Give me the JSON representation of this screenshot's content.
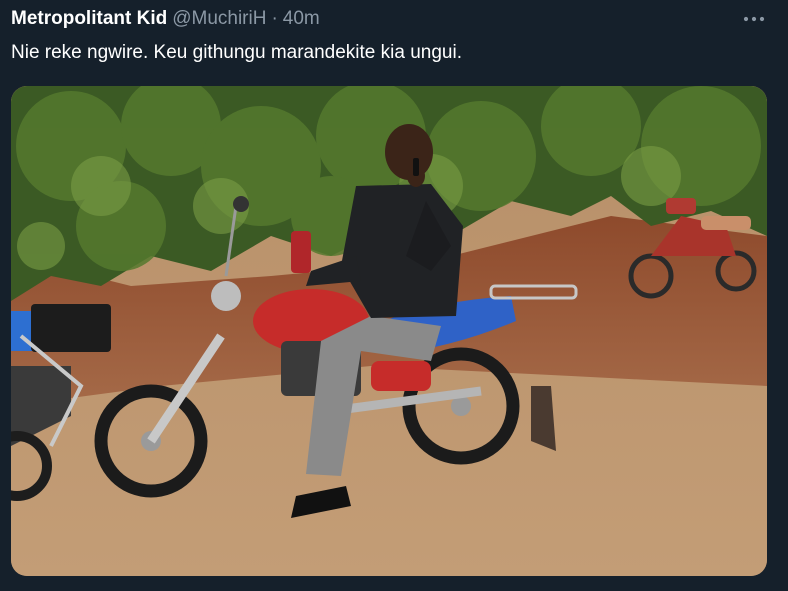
{
  "tweet": {
    "author": {
      "display_name": "Metropolitant Kid",
      "handle": "@MuchiriH",
      "separator": "·",
      "time": "40m"
    },
    "text": "Nie reke ngwire. Keu githungu marandekite kia ungui.",
    "more_icon": "more-horizontal-icon",
    "media": {
      "kind": "photo",
      "subject": "man in black jacket on red and blue motorcycle talking on phone, dirt road, parked motorcycles"
    }
  },
  "colors": {
    "background": "#15202b",
    "primary_text": "#ffffff",
    "secondary_text": "#8b98a5"
  }
}
